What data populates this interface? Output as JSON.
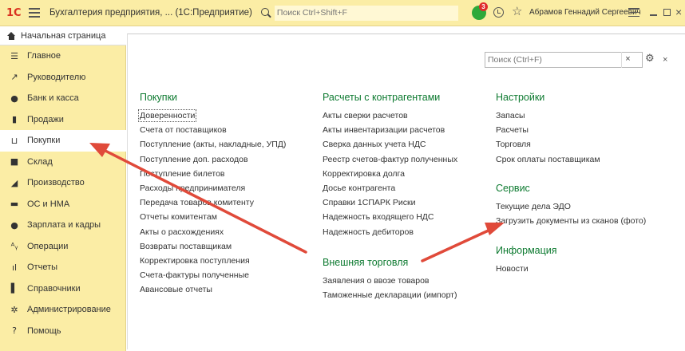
{
  "titlebar": {
    "logo": "1С",
    "app_title": "Бухгалтерия предприятия, ...  (1С:Предприятие)",
    "search_placeholder": "Поиск Ctrl+Shift+F",
    "notification_count": "3",
    "user_name": "Абрамов Геннадий Сергеевич"
  },
  "sidebar": {
    "home_label": "Начальная страница",
    "items": [
      {
        "label": "Главное",
        "icon": "list-icon"
      },
      {
        "label": "Руководителю",
        "icon": "chart-icon"
      },
      {
        "label": "Банк и касса",
        "icon": "bank-icon"
      },
      {
        "label": "Продажи",
        "icon": "bag-icon"
      },
      {
        "label": "Покупки",
        "icon": "cart-icon"
      },
      {
        "label": "Склад",
        "icon": "warehouse-icon"
      },
      {
        "label": "Производство",
        "icon": "factory-icon"
      },
      {
        "label": "ОС и НМА",
        "icon": "truck-icon"
      },
      {
        "label": "Зарплата и кадры",
        "icon": "person-icon"
      },
      {
        "label": "Операции",
        "icon": "operations-icon"
      },
      {
        "label": "Отчеты",
        "icon": "bar-chart-icon"
      },
      {
        "label": "Справочники",
        "icon": "book-icon"
      },
      {
        "label": "Администрирование",
        "icon": "gear-icon"
      },
      {
        "label": "Помощь",
        "icon": "help-icon"
      }
    ],
    "active_index": 4
  },
  "content": {
    "search_placeholder": "Поиск (Ctrl+F)",
    "clear_label": "×",
    "close_label": "×",
    "columns": [
      {
        "head": "Покупки",
        "links": [
          "Доверенности",
          "Счета от поставщиков",
          "Поступление (акты, накладные, УПД)",
          "Поступление доп. расходов",
          "Поступление билетов",
          "Расходы предпринимателя",
          "Передача товаров комитенту",
          "Отчеты комитентам",
          "Акты о расхождениях",
          "Возвраты поставщикам",
          "Корректировка поступления",
          "Счета-фактуры полученные",
          "Авансовые отчеты"
        ]
      },
      {
        "head": "Расчеты с контрагентами",
        "links": [
          "Акты сверки расчетов",
          "Акты инвентаризации расчетов",
          "Сверка данных учета НДС",
          "Реестр счетов-фактур полученных",
          "Корректировка долга",
          "Досье контрагента",
          "Справки 1СПАРК Риски",
          "Надежность входящего НДС",
          "Надежность дебиторов"
        ]
      },
      {
        "head": "Внешняя торговля",
        "links": [
          "Заявления о ввозе товаров",
          "Таможенные декларации (импорт)"
        ]
      },
      {
        "head": "Настройки",
        "links": [
          "Запасы",
          "Расчеты",
          "Торговля",
          "Срок оплаты поставщикам"
        ]
      },
      {
        "head": "Сервис",
        "links": [
          "Текущие дела ЭДО",
          "Загрузить документы из сканов (фото)"
        ]
      },
      {
        "head": "Информация",
        "links": [
          "Новости"
        ]
      }
    ]
  },
  "colors": {
    "panel_bg": "#fbeda5",
    "section_head": "#0d7a30",
    "arrow": "#e04a3a",
    "notification": "#2ea93a",
    "badge": "#e02b2b"
  }
}
